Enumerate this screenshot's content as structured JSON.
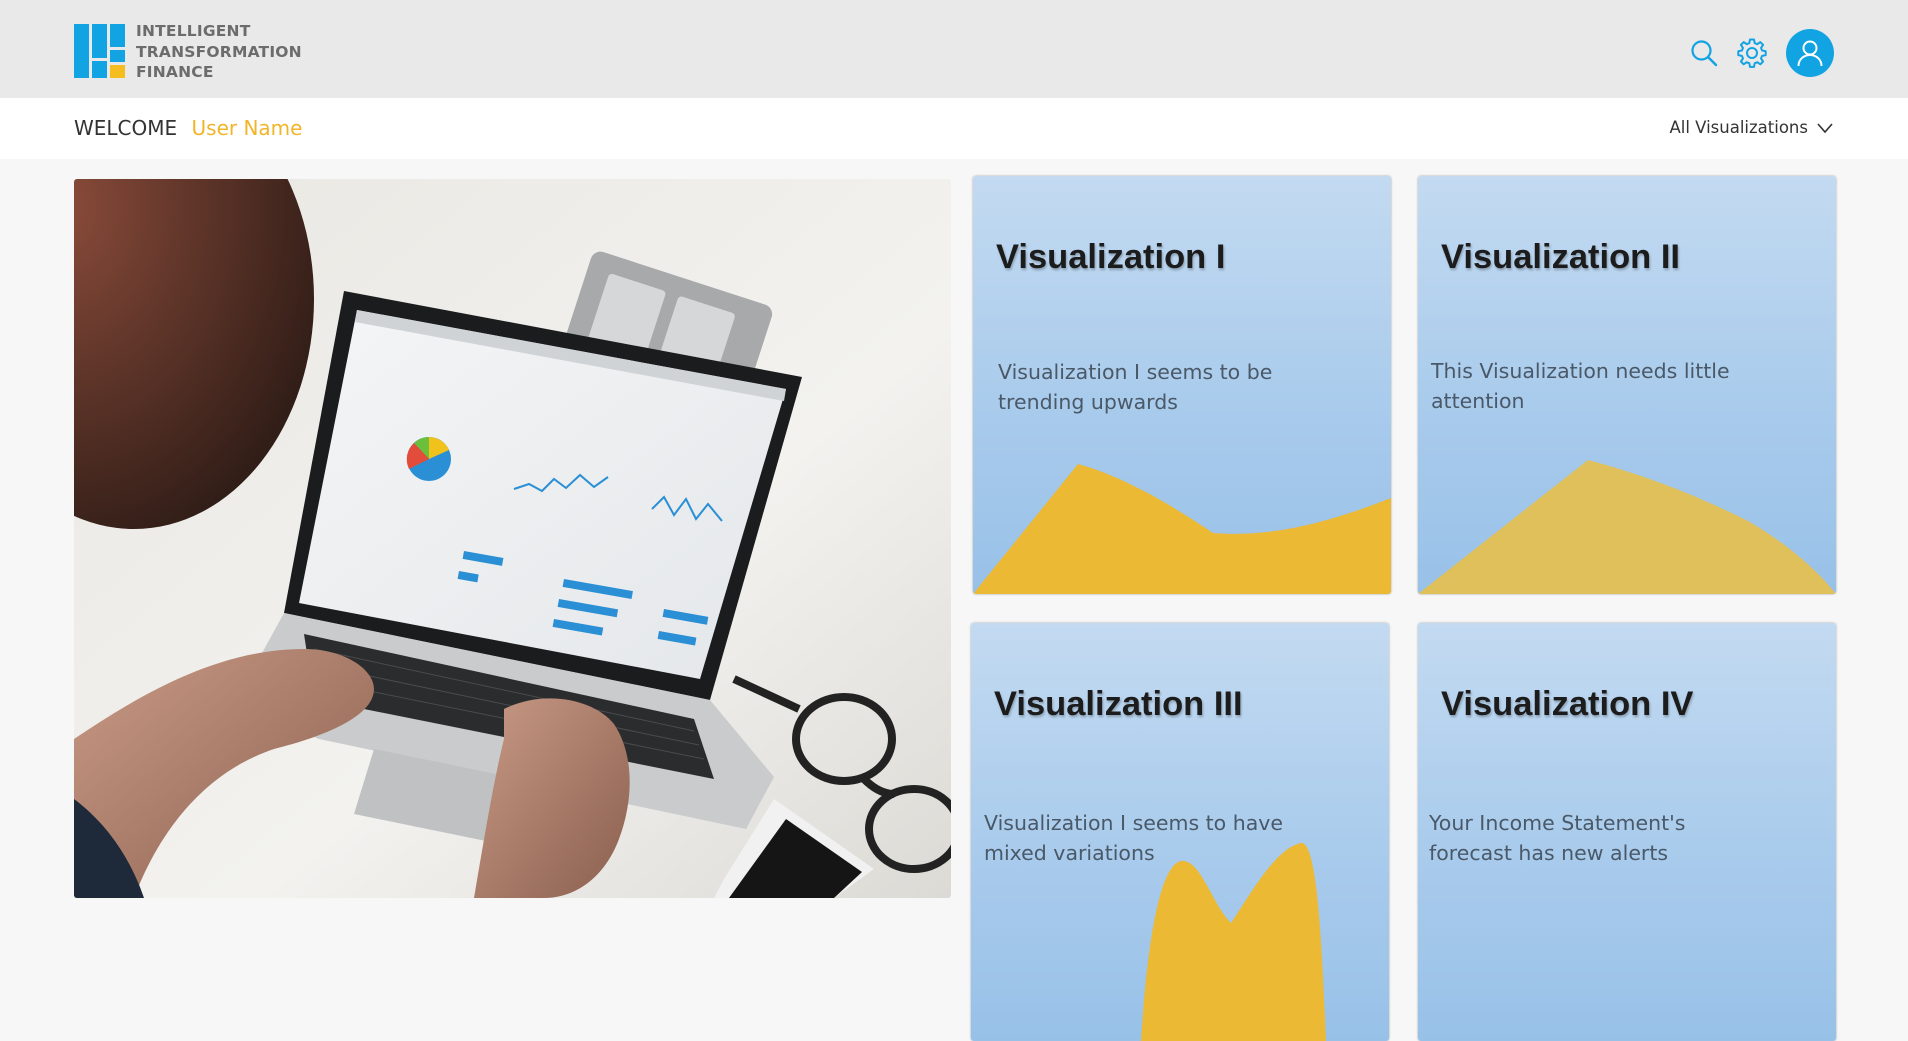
{
  "brand": {
    "name_lines": [
      "INTELLIGENT",
      "TRANSFORMATION",
      "FINANCE"
    ],
    "logo_icon": "grid-logo-icon",
    "primary_color": "#12a3e3",
    "accent_color": "#f0b528"
  },
  "header": {
    "icons": [
      "search-icon",
      "gear-icon",
      "user-avatar-icon"
    ]
  },
  "welcome_bar": {
    "welcome_label": "WELCOME",
    "user_name": "User Name",
    "filter_label": "All Visualizations",
    "filter_icon": "chevron-down-icon"
  },
  "hero": {
    "image": "person using laptop with analytics dashboard"
  },
  "cards": [
    {
      "title": "Visualization I",
      "description": "Visualization I seems to be trending upwards"
    },
    {
      "title": "Visualization II",
      "description": "This Visualization needs little attention"
    },
    {
      "title": "Visualization III",
      "description": "Visualization I seems to have mixed variations"
    },
    {
      "title": "Visualization IV",
      "description": "Your Income Statement's forecast has new alerts"
    }
  ]
}
